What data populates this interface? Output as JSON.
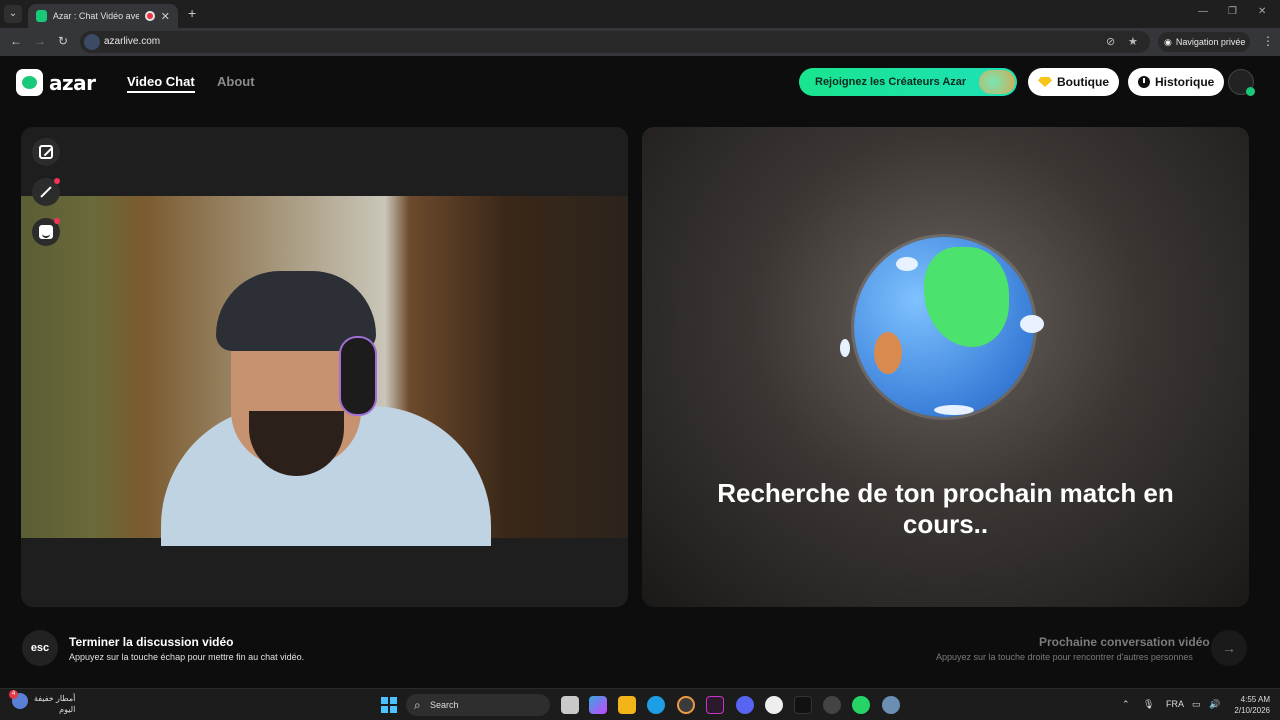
{
  "browser": {
    "tab_title": "Azar : Chat Vidéo avec de n",
    "url": "azarlive.com",
    "private_label": "Navigation privée"
  },
  "app": {
    "logo_text": "azar",
    "nav": [
      {
        "label": "Video Chat",
        "active": true
      },
      {
        "label": "About",
        "active": false
      }
    ],
    "creators_button": "Rejoignez les Créateurs Azar",
    "shop_button": "Boutique",
    "history_button": "Historique"
  },
  "match": {
    "search_text": "Recherche de ton prochain match en cours.."
  },
  "hints": {
    "esc_key": "esc",
    "end_title": "Terminer la discussion vidéo",
    "end_sub": "Appuyez sur la touche échap pour mettre fin au chat vidéo.",
    "next_title": "Prochaine conversation vidéo",
    "next_sub": "Appuyez sur la touche droite pour rencontrer d'autres personnes",
    "next_icon": "→"
  },
  "taskbar": {
    "weather_badge": "4",
    "weather_line1": "أمطار خفيفة",
    "weather_line2": "اليوم",
    "search_label": "Search",
    "lang": "FRA",
    "time": "4:55 AM",
    "date": "2/10/2026"
  },
  "colors": {
    "brand_green": "#19c97a",
    "background": "#0d0d0d"
  }
}
